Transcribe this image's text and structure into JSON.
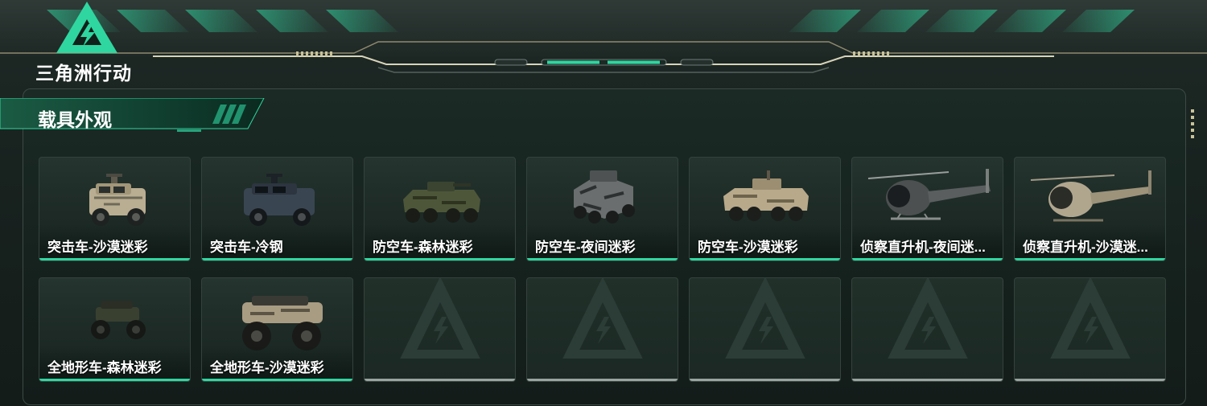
{
  "brand": {
    "logo_text": "三角洲行动",
    "accent": "#2fd6a0"
  },
  "panel": {
    "title": "载具外观"
  },
  "cards": [
    {
      "label": "突击车-沙漠迷彩",
      "icon": "assault-vehicle-desert"
    },
    {
      "label": "突击车-冷钢",
      "icon": "assault-vehicle-coldsteel"
    },
    {
      "label": "防空车-森林迷彩",
      "icon": "aa-vehicle-forest"
    },
    {
      "label": "防空车-夜间迷彩",
      "icon": "aa-vehicle-night"
    },
    {
      "label": "防空车-沙漠迷彩",
      "icon": "aa-vehicle-desert"
    },
    {
      "label": "侦察直升机-夜间迷...",
      "icon": "scout-heli-night"
    },
    {
      "label": "侦察直升机-沙漠迷...",
      "icon": "scout-heli-desert"
    },
    {
      "label": "全地形车-森林迷彩",
      "icon": "atv-forest"
    },
    {
      "label": "全地形车-沙漠迷彩",
      "icon": "atv-desert"
    },
    {
      "label": "",
      "icon": "empty-slot"
    },
    {
      "label": "",
      "icon": "empty-slot"
    },
    {
      "label": "",
      "icon": "empty-slot"
    },
    {
      "label": "",
      "icon": "empty-slot"
    },
    {
      "label": "",
      "icon": "empty-slot"
    }
  ]
}
